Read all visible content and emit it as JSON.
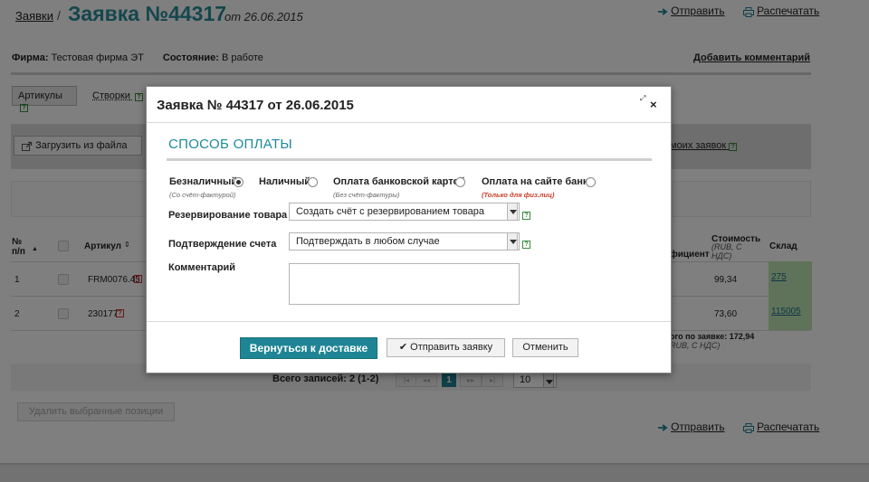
{
  "page": {
    "breadcrumb": "Заявки",
    "breadcrumb_sep": "/",
    "title": "Заявка №44317",
    "date": "от 26.06.2015",
    "send_link": "Отправить",
    "print_link": "Распечатать",
    "firm_label": "Фирма:",
    "firm_value": "Тестовая фирма ЭТ",
    "state_label": "Состояние:",
    "state_value": "В работе",
    "add_comment": "Добавить комментарий",
    "tabs": [
      "Артикулы",
      "Створки"
    ],
    "upload_label": "Загрузить из файла",
    "my_orders": "моих заявок",
    "columns": {
      "num": "№ п/п",
      "article": "Артикул",
      "coef": "фициент",
      "cost": "Стоимость",
      "cost_unit": "(RUB, С НДС)",
      "stock": "Склад"
    },
    "rows": [
      {
        "num": "1",
        "article": "FRM0076.45",
        "cost": "99,34",
        "stock": "275"
      },
      {
        "num": "2",
        "article": "230177",
        "cost": "73,60",
        "stock": "115005"
      }
    ],
    "total_label": "ого по заявке: 172,94",
    "total_unit": "RUB, С НДС)",
    "records_label": "Всего записей: 2 (1-2)",
    "pager_first": "|◂",
    "pager_prev": "◂◂",
    "pager_current": "1",
    "pager_next": "▸▸",
    "pager_last": "▸|",
    "page_size": "10",
    "delete_label": "Удалить выбранные позиции"
  },
  "modal": {
    "title": "Заявка № 44317 от 26.06.2015",
    "close": "×",
    "expand": "⤢",
    "section": "СПОСОБ ОПЛАТЫ",
    "options": [
      {
        "label": "Безналичный",
        "note": "(Со счёт-фактурой)",
        "selected": true
      },
      {
        "label": "Наличный",
        "note": "",
        "selected": false
      },
      {
        "label": "Оплата банковской картой",
        "note": "(Без счёт-фактуры)",
        "selected": false
      },
      {
        "label": "Оплата на сайте банка",
        "note": "(Только для физ.лиц)",
        "selected": false
      }
    ],
    "reserve_label": "Резервирование товара",
    "reserve_value": "Создать счёт с резервированием товара",
    "confirm_label": "Подтверждение счета",
    "confirm_value": "Подтверждать в любом случае",
    "comment_label": "Комментарий",
    "help_glyph": "?",
    "back_button": "Вернуться к доставке",
    "send_button": "Отправить заявку",
    "cancel_button": "Отменить"
  },
  "colors": {
    "accent": "#1f8594",
    "stock_green": "#bfe6b4",
    "red_note": "#c8412b"
  }
}
